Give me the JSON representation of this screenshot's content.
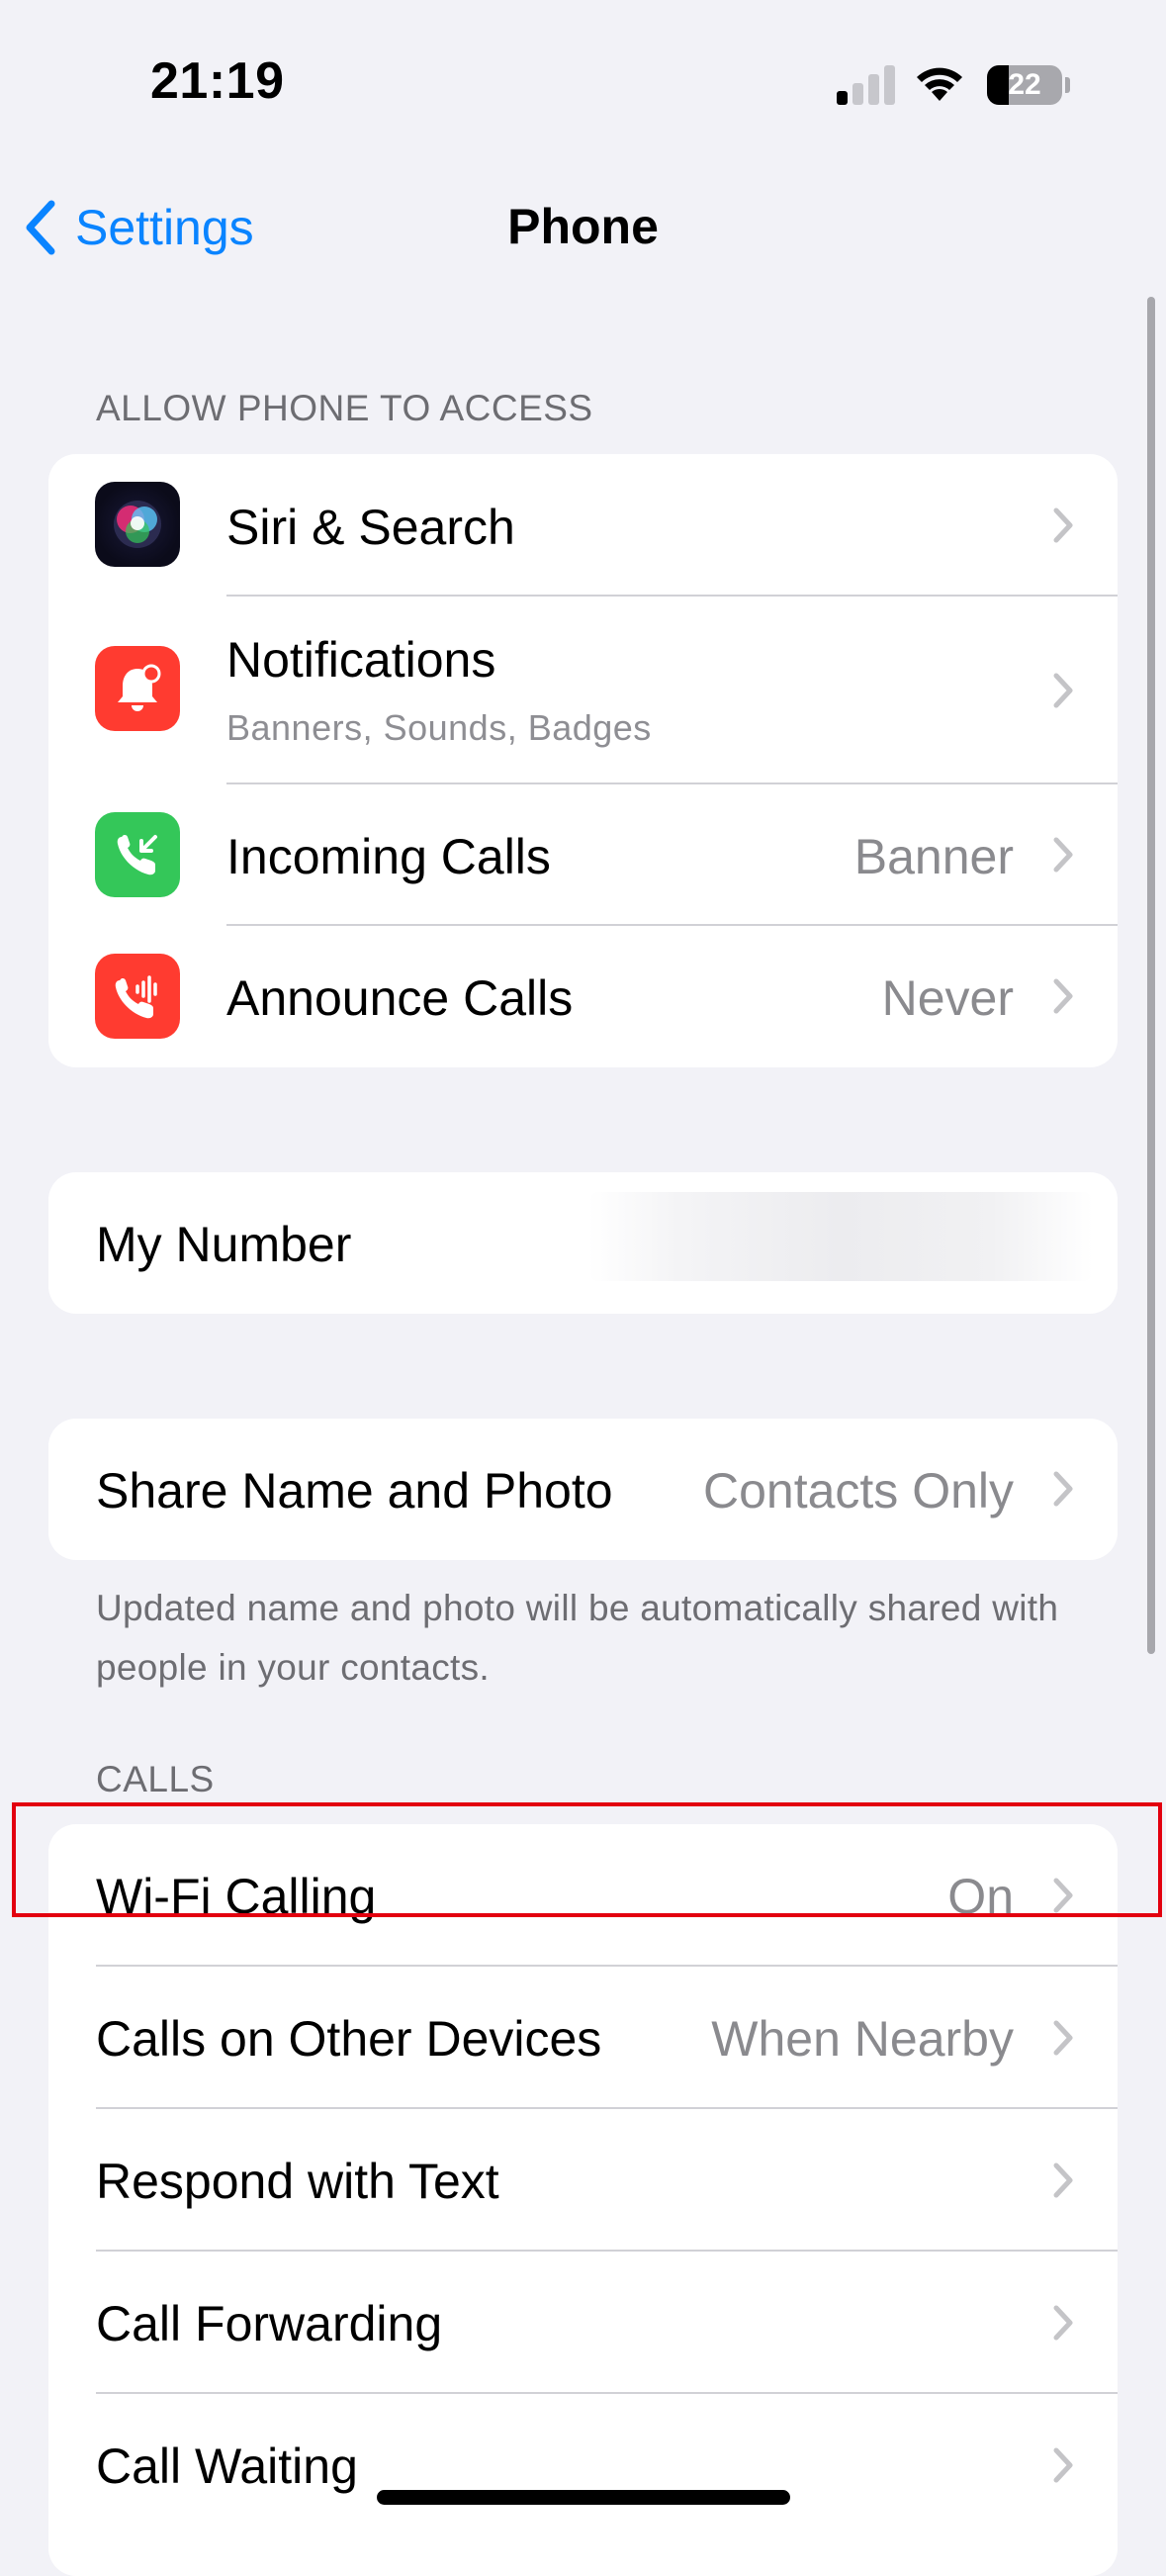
{
  "status_bar": {
    "time": "21:19",
    "battery": "22"
  },
  "nav": {
    "back_label": "Settings",
    "title": "Phone"
  },
  "sections": {
    "allow_access_header": "ALLOW PHONE TO ACCESS",
    "calls_header": "CALLS"
  },
  "access_rows": {
    "siri": {
      "label": "Siri & Search"
    },
    "notifications": {
      "label": "Notifications",
      "subtitle": "Banners, Sounds, Badges"
    },
    "incoming_calls": {
      "label": "Incoming Calls",
      "value": "Banner"
    },
    "announce_calls": {
      "label": "Announce Calls",
      "value": "Never"
    }
  },
  "my_number": {
    "label": "My Number"
  },
  "share_name": {
    "label": "Share Name and Photo",
    "value": "Contacts Only",
    "footer": "Updated name and photo will be automatically shared with people in your contacts."
  },
  "calls_rows": {
    "wifi_calling": {
      "label": "Wi-Fi Calling",
      "value": "On"
    },
    "other_devices": {
      "label": "Calls on Other Devices",
      "value": "When Nearby"
    },
    "respond_text": {
      "label": "Respond with Text"
    },
    "call_forwarding": {
      "label": "Call Forwarding"
    },
    "call_waiting": {
      "label": "Call Waiting"
    }
  },
  "colors": {
    "accent": "#0a84ff",
    "notifications_icon": "#ff3b30",
    "incoming_calls_icon": "#34c759",
    "announce_calls_icon": "#ff3b30",
    "highlight_box": "#e3000f"
  },
  "icons": {
    "siri": "siri-orb-icon",
    "notifications": "bell-badge-icon",
    "incoming_calls": "phone-incoming-icon",
    "announce_calls": "phone-waveform-icon"
  }
}
